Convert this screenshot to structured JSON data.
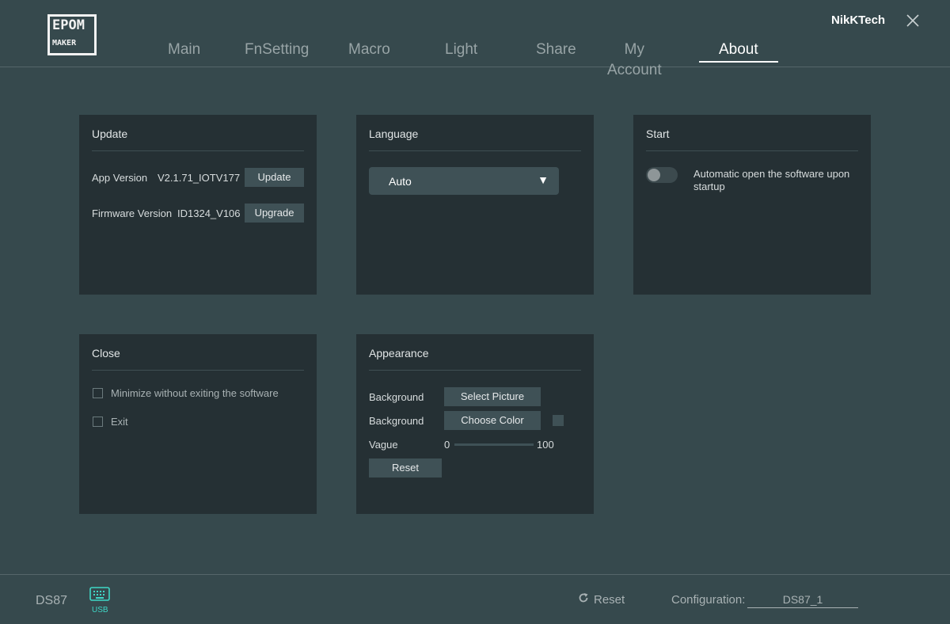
{
  "header": {
    "logo": {
      "line1": "EPOM",
      "line2": "MAKER",
      "letter": "M"
    },
    "username": "NikKTech",
    "nav": [
      {
        "label": "Main"
      },
      {
        "label": "FnSetting"
      },
      {
        "label": "Macro"
      },
      {
        "label": "Light"
      },
      {
        "label": "Share"
      },
      {
        "label": "My Account"
      },
      {
        "label": "About"
      }
    ],
    "active_tab": "About"
  },
  "panels": {
    "update": {
      "title": "Update",
      "app_version_label": "App Version",
      "app_version_value": "V2.1.71_IOTV177",
      "update_button": "Update",
      "firmware_version_label": "Firmware Version",
      "firmware_version_value": "ID1324_V106",
      "upgrade_button": "Upgrade"
    },
    "language": {
      "title": "Language",
      "selected": "Auto",
      "arrow": "▼"
    },
    "start": {
      "title": "Start",
      "toggle_text": "Automatic open the software upon startup",
      "toggle_on": false
    },
    "close": {
      "title": "Close",
      "options": [
        {
          "label": "Minimize without exiting the software",
          "checked": false
        },
        {
          "label": "Exit",
          "checked": false
        }
      ]
    },
    "appearance": {
      "title": "Appearance",
      "bg_picture_label": "Background",
      "select_picture_button": "Select Picture",
      "bg_color_label": "Background",
      "choose_color_button": "Choose Color",
      "vague_label": "Vague",
      "vague_min": "0",
      "vague_max": "100",
      "reset_button": "Reset"
    }
  },
  "footer": {
    "device_name": "DS87",
    "connection": "USB",
    "reset_label": "Reset",
    "config_label": "Configuration:",
    "config_value": "DS87_1"
  },
  "colors": {
    "background": "#36494d",
    "panel": "#253034",
    "button": "#3f5156",
    "accent": "#3fd7c7"
  }
}
